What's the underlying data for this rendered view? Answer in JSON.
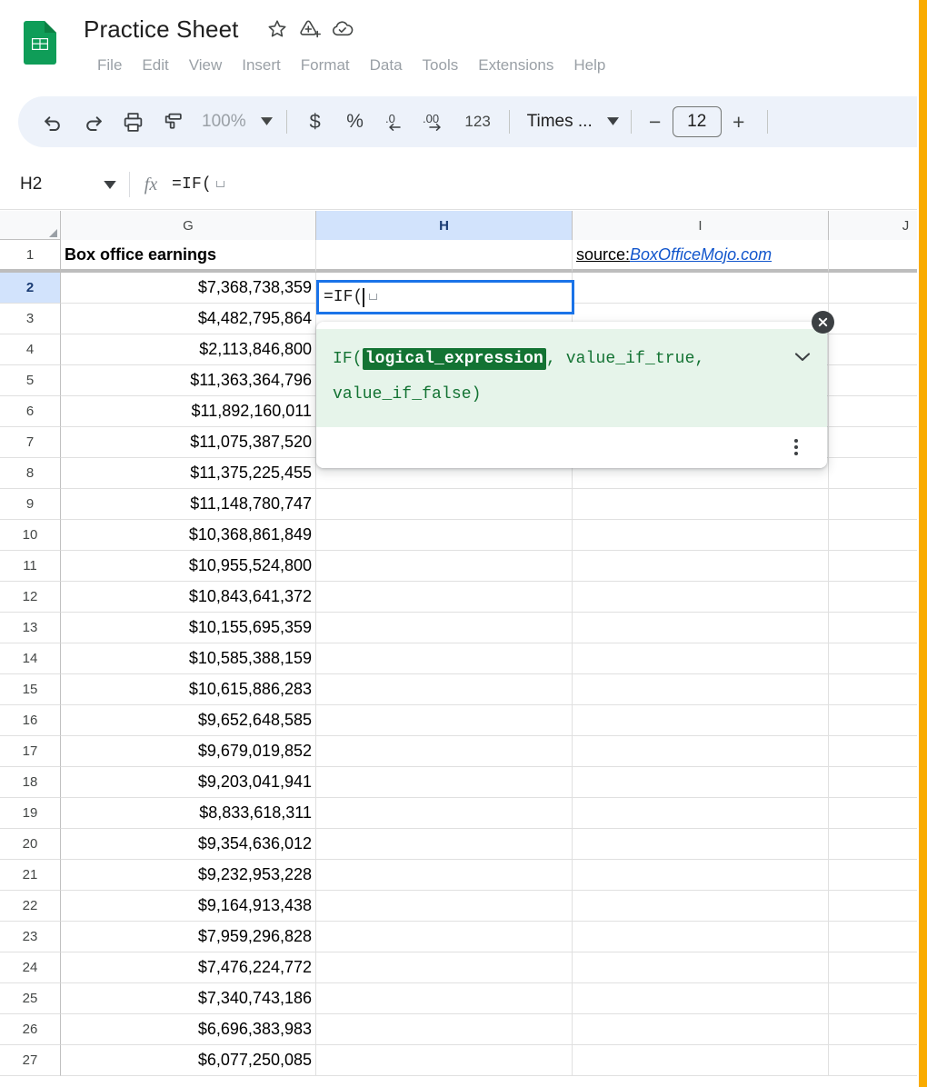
{
  "app": {
    "logo_icon": "sheets-logo-icon",
    "title": "Practice Sheet",
    "header_icons": [
      {
        "name": "star-icon",
        "label": "Star"
      },
      {
        "name": "move-to-drive-icon",
        "label": "Move"
      },
      {
        "name": "saved-to-drive-cloud-icon",
        "label": "Saved"
      }
    ],
    "menus": [
      "File",
      "Edit",
      "View",
      "Insert",
      "Format",
      "Data",
      "Tools",
      "Extensions",
      "Help"
    ]
  },
  "toolbar": {
    "undo_icon": "undo-icon",
    "redo_icon": "redo-icon",
    "print_icon": "print-icon",
    "paint_format_icon": "paint-format-icon",
    "zoom_value": "100%",
    "currency_label": "$",
    "percent_label": "%",
    "decrease_decimal_label": ".0",
    "increase_decimal_label": ".00",
    "number_format_label": "123",
    "font_name": "Times ...",
    "font_size": "12",
    "decrease_font_label": "−",
    "increase_font_label": "+"
  },
  "formula_bar": {
    "name_box_value": "H2",
    "fx_label": "fx",
    "formula_value": "=IF("
  },
  "grid": {
    "columns": [
      "G",
      "H",
      "I",
      "J"
    ],
    "selected_column": "H",
    "selected_row": "2",
    "rows": [
      {
        "n": "1",
        "G": "Box office earnings",
        "H": "",
        "I": "source_link",
        "J": ""
      },
      {
        "n": "2",
        "G": "$7,368,738,359",
        "H": "",
        "I": "",
        "J": ""
      },
      {
        "n": "3",
        "G": "$4,482,795,864",
        "H": "",
        "I": "",
        "J": ""
      },
      {
        "n": "4",
        "G": "$2,113,846,800",
        "H": "",
        "I": "",
        "J": ""
      },
      {
        "n": "5",
        "G": "$11,363,364,796",
        "H": "",
        "I": "",
        "J": ""
      },
      {
        "n": "6",
        "G": "$11,892,160,011",
        "H": "",
        "I": "",
        "J": ""
      },
      {
        "n": "7",
        "G": "$11,075,387,520",
        "H": "",
        "I": "",
        "J": ""
      },
      {
        "n": "8",
        "G": "$11,375,225,455",
        "H": "",
        "I": "",
        "J": ""
      },
      {
        "n": "9",
        "G": "$11,148,780,747",
        "H": "",
        "I": "",
        "J": ""
      },
      {
        "n": "10",
        "G": "$10,368,861,849",
        "H": "",
        "I": "",
        "J": ""
      },
      {
        "n": "11",
        "G": "$10,955,524,800",
        "H": "",
        "I": "",
        "J": ""
      },
      {
        "n": "12",
        "G": "$10,843,641,372",
        "H": "",
        "I": "",
        "J": ""
      },
      {
        "n": "13",
        "G": "$10,155,695,359",
        "H": "",
        "I": "",
        "J": ""
      },
      {
        "n": "14",
        "G": "$10,585,388,159",
        "H": "",
        "I": "",
        "J": ""
      },
      {
        "n": "15",
        "G": "$10,615,886,283",
        "H": "",
        "I": "",
        "J": ""
      },
      {
        "n": "16",
        "G": "$9,652,648,585",
        "H": "",
        "I": "",
        "J": ""
      },
      {
        "n": "17",
        "G": "$9,679,019,852",
        "H": "",
        "I": "",
        "J": ""
      },
      {
        "n": "18",
        "G": "$9,203,041,941",
        "H": "",
        "I": "",
        "J": ""
      },
      {
        "n": "19",
        "G": "$8,833,618,311",
        "H": "",
        "I": "",
        "J": ""
      },
      {
        "n": "20",
        "G": "$9,354,636,012",
        "H": "",
        "I": "",
        "J": ""
      },
      {
        "n": "21",
        "G": "$9,232,953,228",
        "H": "",
        "I": "",
        "J": ""
      },
      {
        "n": "22",
        "G": "$9,164,913,438",
        "H": "",
        "I": "",
        "J": ""
      },
      {
        "n": "23",
        "G": "$7,959,296,828",
        "H": "",
        "I": "",
        "J": ""
      },
      {
        "n": "24",
        "G": "$7,476,224,772",
        "H": "",
        "I": "",
        "J": ""
      },
      {
        "n": "25",
        "G": "$7,340,743,186",
        "H": "",
        "I": "",
        "J": ""
      },
      {
        "n": "26",
        "G": "$6,696,383,983",
        "H": "",
        "I": "",
        "J": ""
      },
      {
        "n": "27",
        "G": "$6,077,250,085",
        "H": "",
        "I": "",
        "J": ""
      }
    ],
    "source_prefix": "source: ",
    "source_link_text": "BoxOfficeMojo.com"
  },
  "cell_editor": {
    "value": "=IF("
  },
  "formula_help": {
    "fn_open": "IF(",
    "active_param": "logical_expression",
    "rest": ", value_if_true, value_if_false)",
    "chevron_icon": "chevron-down-icon",
    "more_icon": "more-vert-icon",
    "close_icon": "close-icon"
  },
  "colors": {
    "accent_blue": "#1a73e8",
    "selection_header": "#d2e3fc",
    "toolbar_bg": "#edf2fa",
    "help_bg": "#e6f4ea",
    "help_text": "#137333",
    "link": "#1155cc",
    "window_edge": "#f9ab00"
  }
}
